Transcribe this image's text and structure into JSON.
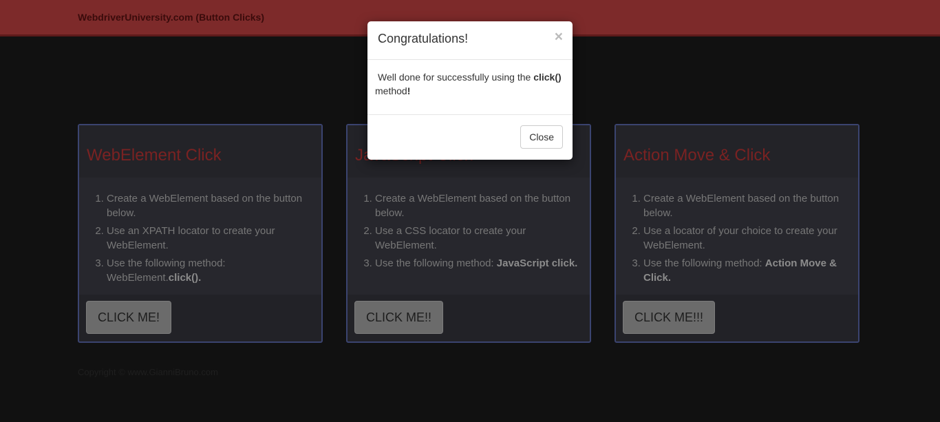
{
  "navbar": {
    "brand": "WebdriverUniversity.com (Button Clicks)"
  },
  "panels": [
    {
      "title": "WebElement Click",
      "steps": [
        {
          "text": "Create a WebElement based on the button below."
        },
        {
          "text": "Use an XPATH locator to create your WebElement."
        },
        {
          "text": "Use the following method: WebElement.",
          "bold": "click()."
        }
      ],
      "button": "CLICK ME!"
    },
    {
      "title": "JavaScript Click",
      "steps": [
        {
          "text": "Create a WebElement based on the button below."
        },
        {
          "text": "Use a CSS locator to create your WebElement."
        },
        {
          "text": "Use the following method: ",
          "bold": "JavaScript click."
        }
      ],
      "button": "CLICK ME!!"
    },
    {
      "title": "Action Move & Click",
      "steps": [
        {
          "text": "Create a WebElement based on the button below."
        },
        {
          "text": "Use a locator of your choice to create your WebElement."
        },
        {
          "text": "Use the following method: ",
          "bold": "Action Move & Click."
        }
      ],
      "button": "CLICK ME!!!"
    }
  ],
  "footer": {
    "copyright": "Copyright © www.GianniBruno.com"
  },
  "modal": {
    "title": "Congratulations!",
    "close_symbol": "×",
    "body_before": "Well done for successfully using the ",
    "body_bold": "click()",
    "body_after": " method",
    "body_end": "!",
    "close_button": "Close"
  }
}
